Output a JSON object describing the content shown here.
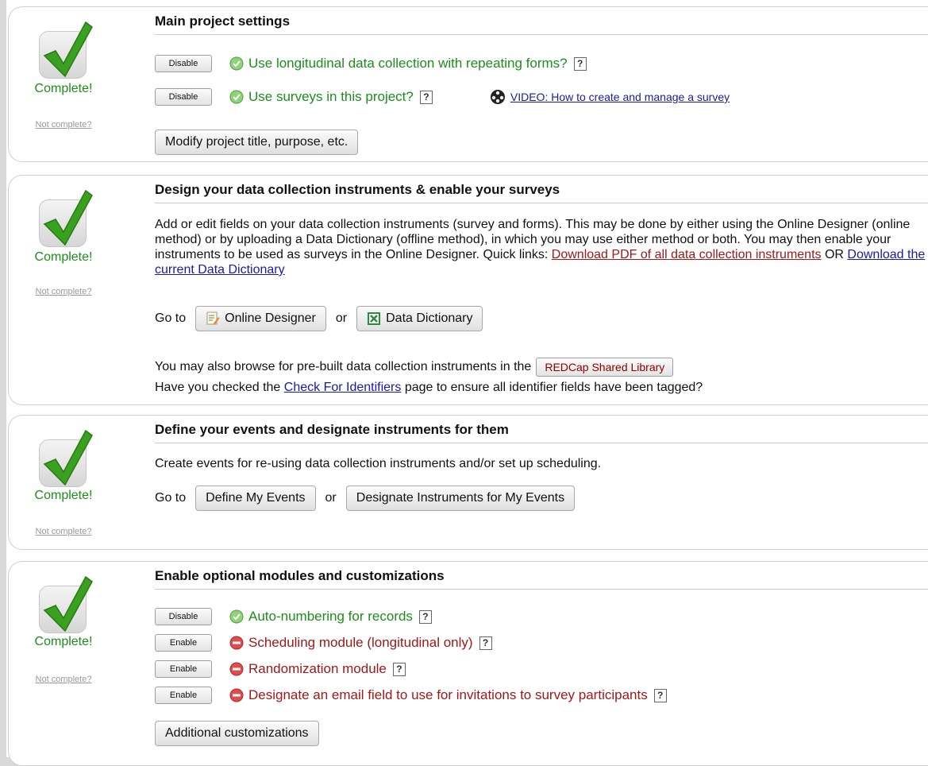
{
  "status": {
    "complete": "Complete!",
    "not_complete": "Not complete?"
  },
  "main": {
    "title": "Main project settings",
    "items": [
      {
        "button": "Disable",
        "text": "Use longitudinal data collection with repeating forms?",
        "help": "?"
      },
      {
        "button": "Disable",
        "text": "Use surveys in this project?",
        "help": "?"
      }
    ],
    "video_link": "VIDEO: How to create and manage a survey",
    "modify_button": "Modify project title, purpose, etc."
  },
  "design": {
    "title": "Design your data collection instruments & enable your surveys",
    "description": "Add or edit fields on your data collection instruments (survey and forms). This may be done by either using the Online Designer (online method) or by uploading a Data Dictionary (offline method), in which you may use either method or both. You may then enable your instruments to be used as surveys in the Online Designer. Quick links: ",
    "pdf_link": "Download PDF of all data collection instruments",
    "or_text": " OR ",
    "dict_link": "Download the current Data Dictionary",
    "goto": "Go to",
    "or": "or",
    "online_designer": "Online Designer",
    "data_dictionary": "Data Dictionary",
    "library_text": "You may also browse for pre-built data collection instruments in the",
    "library_button": "REDCap Shared Library",
    "identifiers_pre": "Have you checked the ",
    "identifiers_link": "Check For Identifiers",
    "identifiers_post": " page to ensure all identifier fields have been tagged?"
  },
  "events": {
    "title": "Define your events and designate instruments for them",
    "description": "Create events for re-using data collection instruments and/or set up scheduling.",
    "goto": "Go to",
    "or": "or",
    "define_button": "Define My Events",
    "designate_button": "Designate Instruments for My Events"
  },
  "modules": {
    "title": "Enable optional modules and customizations",
    "items": [
      {
        "button": "Disable",
        "text": "Auto-numbering for records",
        "help": "?",
        "enabled": true
      },
      {
        "button": "Enable",
        "text": "Scheduling module (longitudinal only)",
        "help": "?",
        "enabled": false
      },
      {
        "button": "Enable",
        "text": "Randomization module",
        "help": "?",
        "enabled": false
      },
      {
        "button": "Enable",
        "text": "Designate an email field to use for invitations to survey participants",
        "help": "?",
        "enabled": false
      }
    ],
    "custom_button": "Additional customizations"
  },
  "colors": {
    "green": "#1c8d1c",
    "red": "#a01818",
    "link": "#1a1aa6"
  }
}
